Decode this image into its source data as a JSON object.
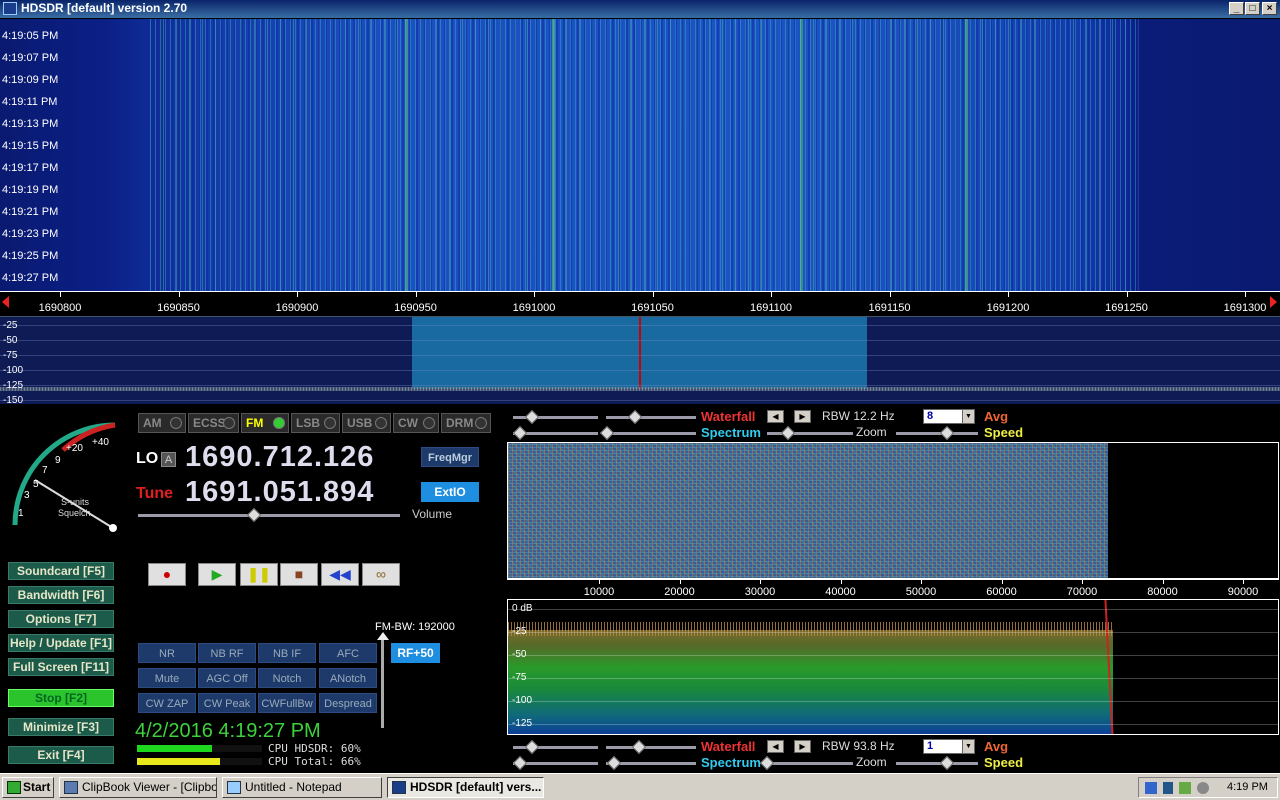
{
  "window": {
    "title": "HDSDR [default]  version 2.70",
    "buttons": [
      "_",
      "□",
      "×"
    ]
  },
  "waterfall": {
    "timestamps": [
      "4:19:05 PM",
      "4:19:07 PM",
      "4:19:09 PM",
      "4:19:11 PM",
      "4:19:13 PM",
      "4:19:15 PM",
      "4:19:17 PM",
      "4:19:19 PM",
      "4:19:21 PM",
      "4:19:23 PM",
      "4:19:25 PM",
      "4:19:27 PM"
    ],
    "freq_labels": [
      "1690800",
      "1690850",
      "1690900",
      "1690950",
      "1691000",
      "1691050",
      "1691100",
      "1691150",
      "1691200",
      "1691250",
      "1691300"
    ]
  },
  "spectrum": {
    "db_labels": [
      "-25",
      "-50",
      "-75",
      "-100",
      "-125",
      "-150"
    ]
  },
  "modes": [
    {
      "label": "AM",
      "active": false
    },
    {
      "label": "ECSS",
      "active": false
    },
    {
      "label": "FM",
      "active": true
    },
    {
      "label": "LSB",
      "active": false
    },
    {
      "label": "USB",
      "active": false
    },
    {
      "label": "CW",
      "active": false
    },
    {
      "label": "DRM",
      "active": false
    }
  ],
  "smeter": {
    "scale": [
      "1",
      "3",
      "5",
      "7",
      "9",
      "+20",
      "+40"
    ],
    "label1": "S-units",
    "label2": "Squelch"
  },
  "lo": {
    "label": "LO",
    "badge": "A",
    "value": "1690.712.126"
  },
  "tune": {
    "label": "Tune",
    "value": "1691.051.894"
  },
  "buttons": {
    "freqmgr": "FreqMgr",
    "extio": "ExtIO",
    "volume": "Volume",
    "soundcard": "Soundcard  [F5]",
    "bandwidth": "Bandwidth  [F6]",
    "options": "Options  [F7]",
    "help": "Help / Update  [F1]",
    "fullscreen": "Full Screen  [F11]",
    "stop": "Stop      [F2]",
    "minimize": "Minimize  [F3]",
    "exit": "Exit      [F4]",
    "rf50": "RF+50"
  },
  "fm_bw": "FM-BW: 192000",
  "dsp": [
    [
      "NR",
      "NB RF",
      "NB IF",
      "AFC"
    ],
    [
      "Mute",
      "AGC Off",
      "Notch",
      "ANotch"
    ],
    [
      "CW ZAP",
      "CW Peak",
      "CWFullBw",
      "Despread"
    ]
  ],
  "status": {
    "datetime": "4/2/2016 4:19:27 PM",
    "cpu_hdsdr": "CPU HDSDR: 60%",
    "cpu_total": "CPU Total: 66%",
    "cpu_hdsdr_level": 0.6,
    "cpu_total_level": 0.66
  },
  "rf_panel": {
    "waterfall": "Waterfall",
    "spectrum": "Spectrum",
    "rbw": "RBW 12.2 Hz",
    "avg_value": "8",
    "avg": "Avg",
    "zoom": "Zoom",
    "speed": "Speed"
  },
  "af_panel": {
    "waterfall": "Waterfall",
    "spectrum": "Spectrum",
    "rbw": "RBW 93.8 Hz",
    "avg_value": "1",
    "avg": "Avg",
    "zoom": "Zoom",
    "speed": "Speed"
  },
  "audio": {
    "freq_labels": [
      "10000",
      "20000",
      "30000",
      "40000",
      "50000",
      "60000",
      "70000",
      "80000",
      "90000"
    ],
    "db_labels": [
      "0 dB",
      "-25",
      "-50",
      "-75",
      "-100",
      "-125"
    ]
  },
  "taskbar": {
    "start": "Start",
    "items": [
      "ClipBook Viewer - [Clipbo...",
      "Untitled - Notepad",
      "HDSDR [default]  vers..."
    ],
    "clock": "4:19 PM"
  },
  "colors": {
    "accent_cyan": "#1e8ee0",
    "stop_green": "#2cc42c",
    "datetime_green": "#3cd23c",
    "tune_red": "#e02020"
  }
}
